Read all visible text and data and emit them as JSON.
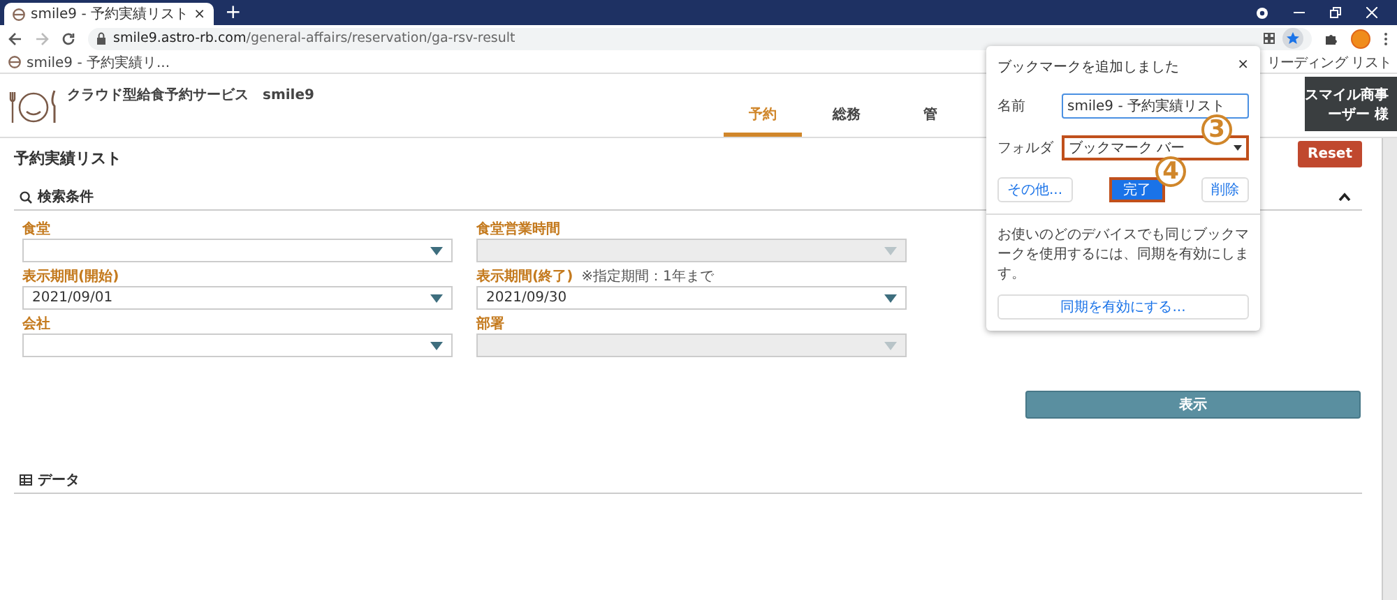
{
  "browser": {
    "tab": {
      "title": "smile9 - 予約実績リスト",
      "close": "×"
    },
    "new_tab": "+",
    "url": {
      "host": "smile9.astro-rb.com",
      "path": "/general-affairs/reservation/ga-rsv-result"
    },
    "bookmarks": [
      {
        "label": "smile9 - 予約実績リ..."
      }
    ],
    "reading_list": "リーディング リスト"
  },
  "app": {
    "title": "クラウド型給食予約サービス　smile9",
    "nav": [
      {
        "label": "予約",
        "selected": true
      },
      {
        "label": "総務",
        "selected": false
      },
      {
        "label": "管",
        "selected": false
      }
    ],
    "user": [
      "スマイル商事",
      "ーザー 様"
    ],
    "reset": "Reset"
  },
  "page": {
    "title": "予約実績リスト",
    "search_title": "検索条件",
    "fields": [
      {
        "label": "食堂",
        "disabled": false
      },
      {
        "label": "食堂営業時間",
        "disabled": true
      },
      {
        "label": "表示期間(開始)",
        "value": "2021/09/01",
        "disabled": false
      },
      {
        "label": "表示期間(終了)",
        "note": "※指定期間：1年まで",
        "value": "2021/09/30",
        "disabled": false
      },
      {
        "label": "会社",
        "disabled": false
      },
      {
        "label": "部署",
        "disabled": true
      }
    ],
    "submit": "表示",
    "data_title": "データ"
  },
  "popup": {
    "title": "ブックマークを追加しました",
    "close": "×",
    "name_label": "名前",
    "name_value": "smile9 - 予約実績リスト",
    "folder_label": "フォルダ",
    "folder_value": "ブックマーク バー",
    "buttons": [
      {
        "label": "その他...",
        "kind": "plain"
      },
      {
        "label": "完了",
        "kind": "primary"
      },
      {
        "label": "削除",
        "kind": "plain"
      }
    ],
    "sync_text": "お使いのどのデバイスでも同じブックマークを使用するには、同期を有効にします。",
    "sync_button": "同期を有効にする..."
  },
  "callouts": [
    "3",
    "4"
  ]
}
